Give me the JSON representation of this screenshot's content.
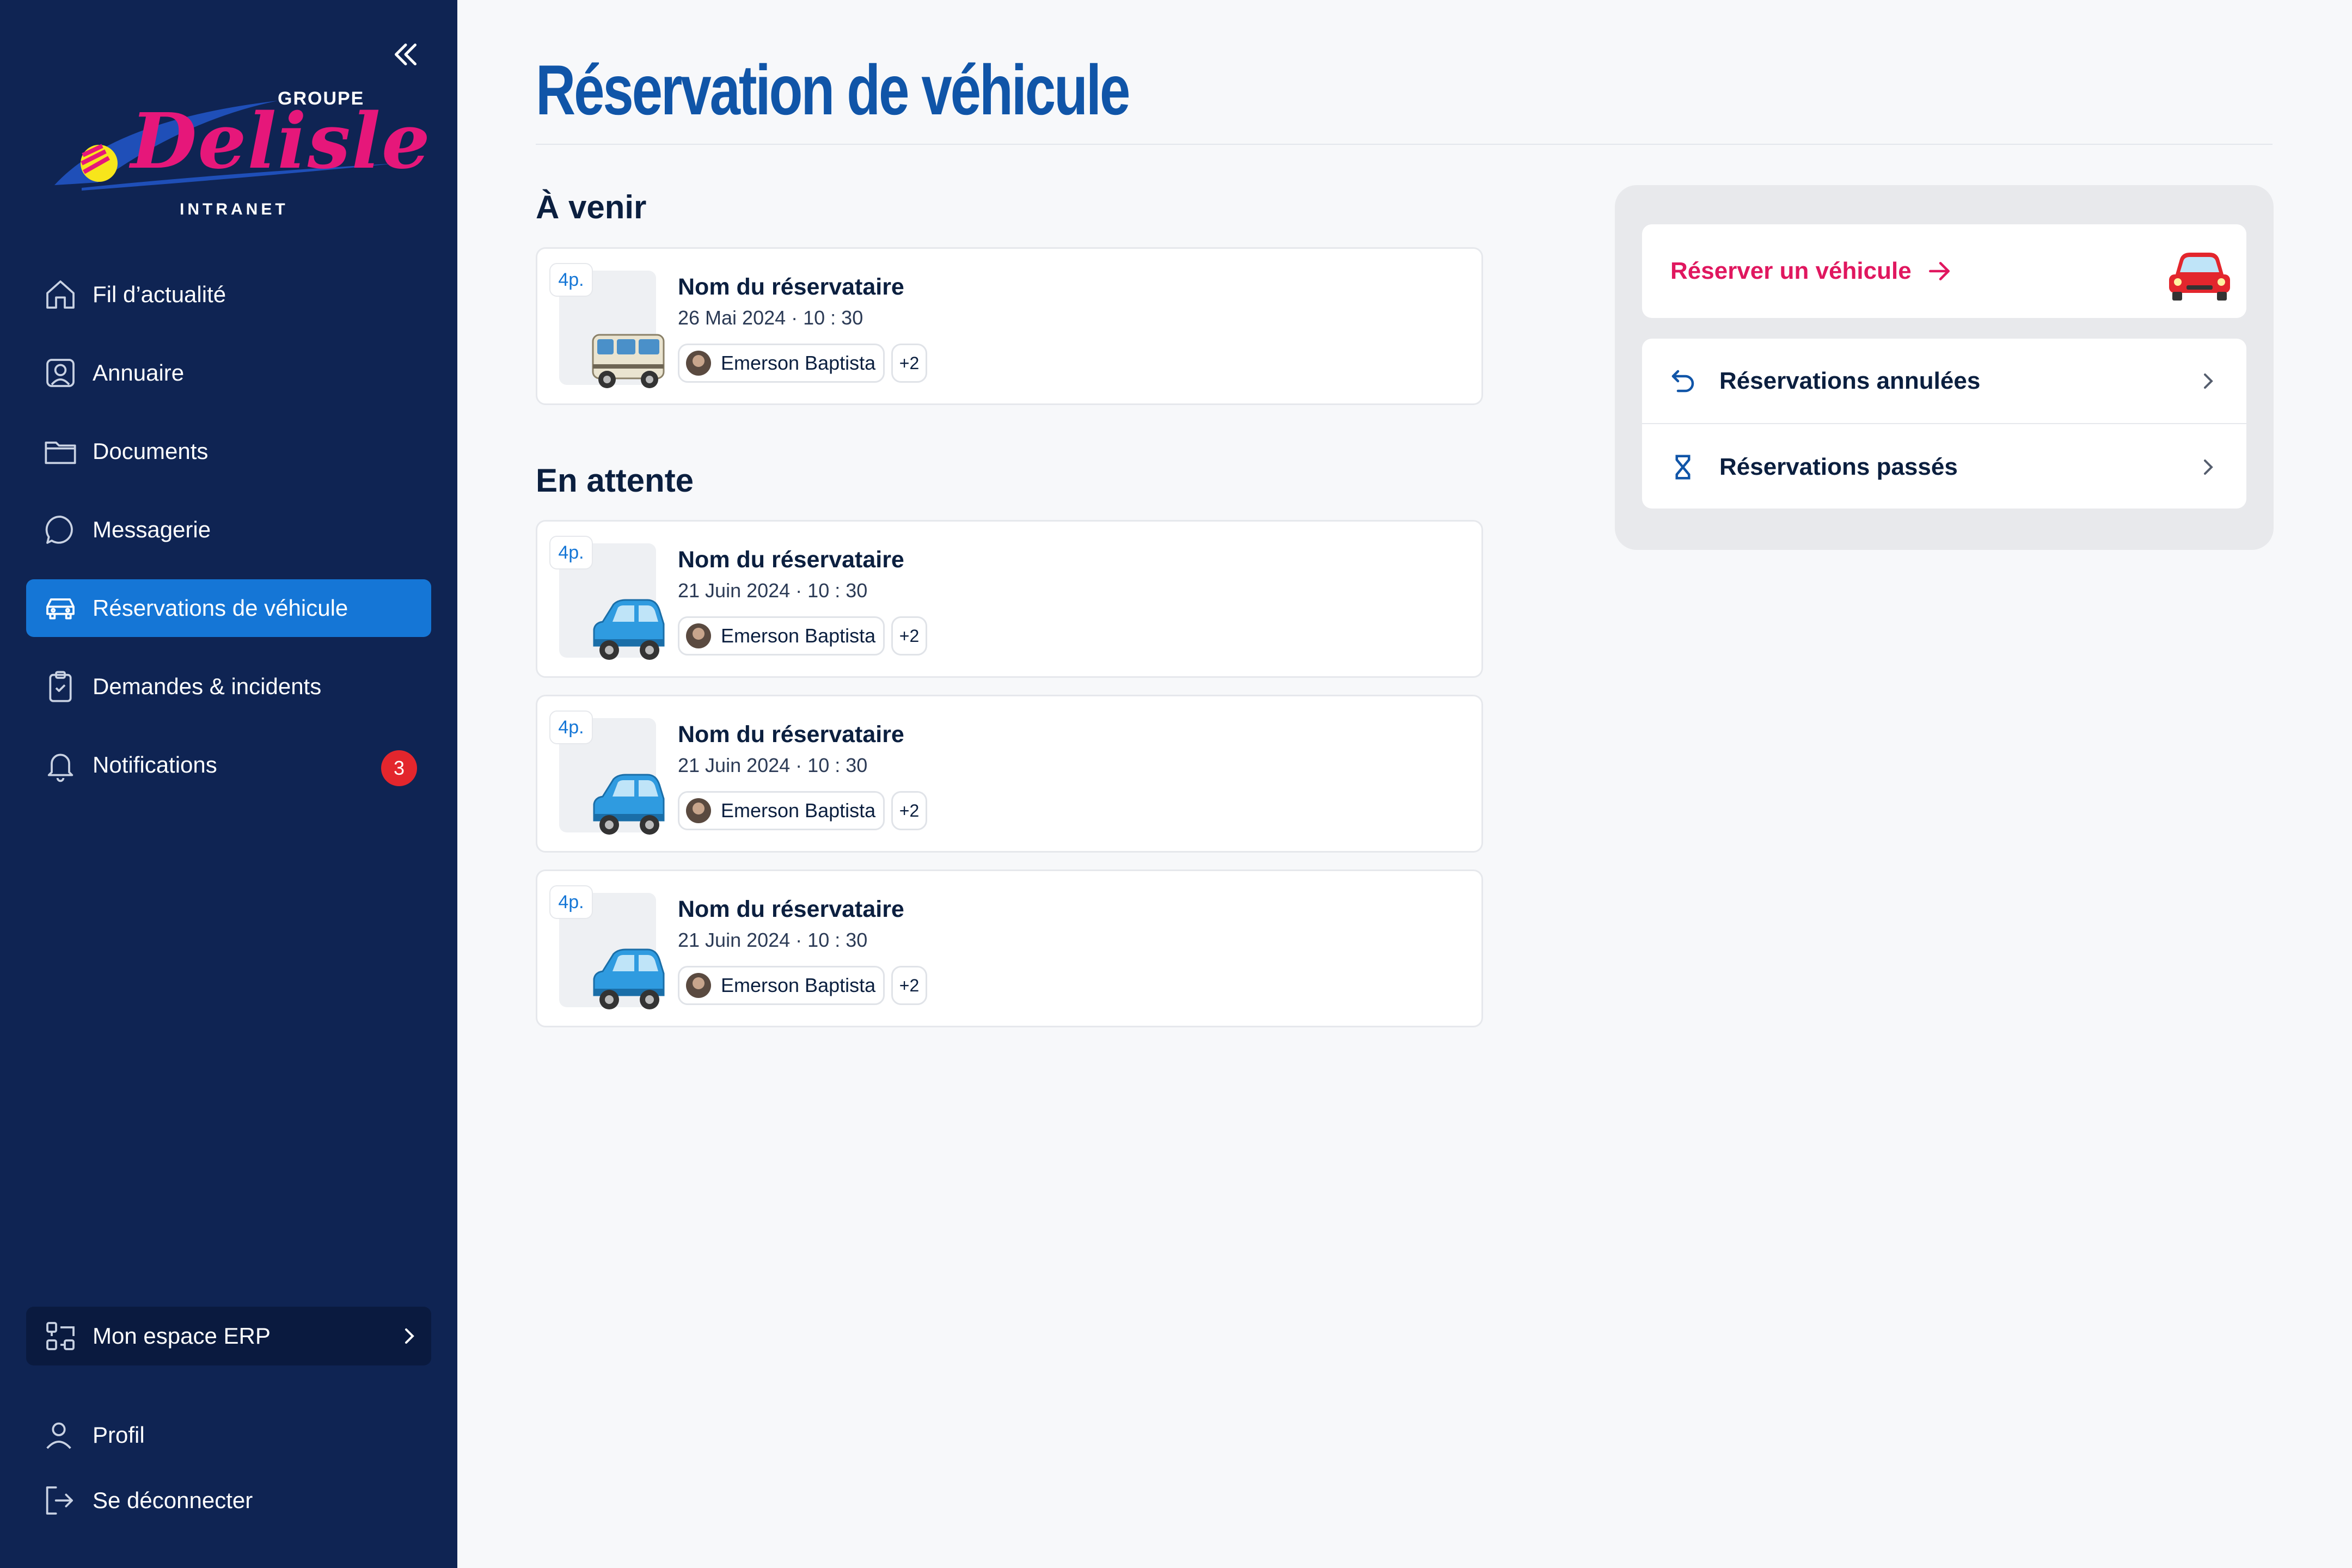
{
  "sidebar": {
    "logo": {
      "groupe": "GROUPE",
      "brand": "Delisle",
      "intranet": "INTRANET"
    },
    "nav": [
      {
        "label": "Fil d’actualité",
        "icon": "home-icon"
      },
      {
        "label": "Annuaire",
        "icon": "contact-card-icon"
      },
      {
        "label": "Documents",
        "icon": "folder-icon"
      },
      {
        "label": "Messagerie",
        "icon": "chat-bubble-icon"
      },
      {
        "label": "Réservations de véhicule",
        "icon": "car-icon",
        "active": true
      },
      {
        "label": "Demandes & incidents",
        "icon": "clipboard-check-icon"
      },
      {
        "label": "Notifications",
        "icon": "bell-icon",
        "badge": "3"
      }
    ],
    "erp": {
      "label": "Mon espace ERP",
      "icon": "erp-grid-icon"
    },
    "profile": "Profil",
    "logout": "Se déconnecter"
  },
  "main": {
    "title": "Réservation de véhicule",
    "upcoming_heading": "À venir",
    "pending_heading": "En attente",
    "upcoming": [
      {
        "seats": "4p.",
        "vehicle": "van",
        "name": "Nom du réservataire",
        "date": "26 Mai 2024 · 10 : 30",
        "person": "Emerson Baptista",
        "more": "+2"
      }
    ],
    "pending": [
      {
        "seats": "4p.",
        "vehicle": "car",
        "name": "Nom du réservataire",
        "date": "21 Juin 2024 · 10 : 30",
        "person": "Emerson Baptista",
        "more": "+2"
      },
      {
        "seats": "4p.",
        "vehicle": "car",
        "name": "Nom du réservataire",
        "date": "21 Juin 2024 · 10 : 30",
        "person": "Emerson Baptista",
        "more": "+2"
      },
      {
        "seats": "4p.",
        "vehicle": "car",
        "name": "Nom du réservataire",
        "date": "21 Juin 2024 · 10 : 30",
        "person": "Emerson Baptista",
        "more": "+2"
      }
    ]
  },
  "panel": {
    "reserve_label": "Réserver un véhicule",
    "cancelled_label": "Réservations annulées",
    "past_label": "Réservations passés"
  },
  "colors": {
    "sidebar": "#0f2453",
    "active": "#1576d6",
    "title": "#1055a8",
    "accent": "#e0175f",
    "badge": "#e3262d"
  }
}
